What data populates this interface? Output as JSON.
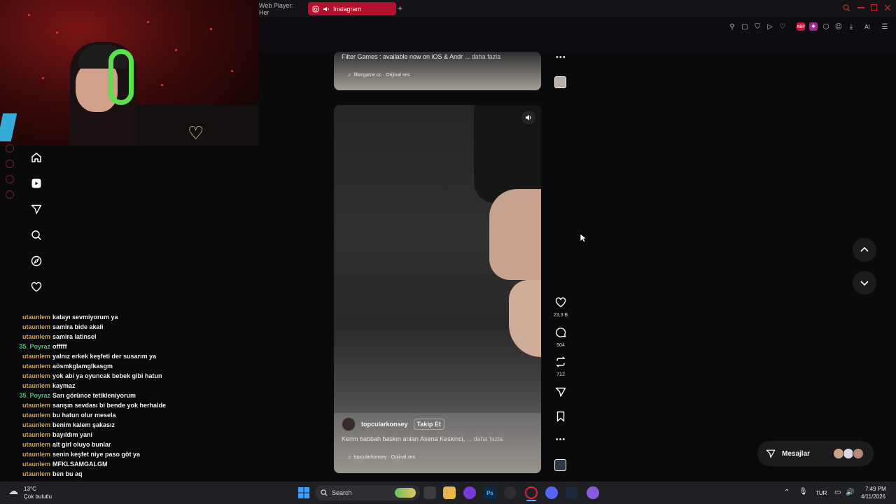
{
  "browser": {
    "tabs": [
      {
        "label": "Web Player: Her"
      },
      {
        "label": "Instagram"
      }
    ],
    "new_tab": "+",
    "ai_label": "AI"
  },
  "instagram": {
    "reel_top": {
      "caption": "Filter Games : available now on iOS & Andr",
      "more": "... daha fazla",
      "audio": "filtergame.cc · Orijinal ses"
    },
    "reel_main": {
      "username": "topcularkonsey",
      "follow": "Takip Et",
      "caption": "Kerim babbah baskın anları Asena Keskinci,",
      "more": "... daha fazla",
      "audio": "topcularkonsey · Orijinal ses"
    },
    "actions": {
      "likes": "23,3 B",
      "comments": "504",
      "reposts": "712"
    },
    "messages_label": "Mesajlar"
  },
  "chat": [
    {
      "user": "utaunlem",
      "msg": "katayı sevmiyorum ya",
      "color": "#d9a84a"
    },
    {
      "user": "utaunlem",
      "msg": "samira bide akali",
      "color": "#d9a84a"
    },
    {
      "user": "utaunlem",
      "msg": "samira latinsel",
      "color": "#d9a84a"
    },
    {
      "user": "35_Poyraz",
      "msg": "offfff",
      "color": "#4ec87a"
    },
    {
      "user": "utaunlem",
      "msg": "yalnız erkek keşfeti der susarım ya",
      "color": "#d9a84a"
    },
    {
      "user": "utaunlem",
      "msg": "aösmkglamglkasgm",
      "color": "#d9a84a"
    },
    {
      "user": "utaunlem",
      "msg": "yok abi ya oyuncak bebek gibi hatun",
      "color": "#d9a84a"
    },
    {
      "user": "utaunlem",
      "msg": "kaymaz",
      "color": "#d9a84a"
    },
    {
      "user": "35_Poyraz",
      "msg": "Sarı görünce tetikleniyorum",
      "color": "#4ec87a"
    },
    {
      "user": "utaunlem",
      "msg": "sarışın sevdası bi bende yok herhalde",
      "color": "#d9a84a"
    },
    {
      "user": "utaunlem",
      "msg": "bu hatun olur mesela",
      "color": "#d9a84a"
    },
    {
      "user": "utaunlem",
      "msg": "benim kalem şakasız",
      "color": "#d9a84a"
    },
    {
      "user": "utaunlem",
      "msg": "bayıldım yani",
      "color": "#d9a84a"
    },
    {
      "user": "utaunlem",
      "msg": "alt girl oluyo bunlar",
      "color": "#d9a84a"
    },
    {
      "user": "utaunlem",
      "msg": "senin keşfet niye paso göt ya",
      "color": "#d9a84a"
    },
    {
      "user": "utaunlem",
      "msg": "MFKLSAMGALGM",
      "color": "#d9a84a"
    },
    {
      "user": "utaunlem",
      "msg": "ben bu aq",
      "color": "#d9a84a"
    }
  ],
  "taskbar": {
    "weather_temp": "13°C",
    "weather_desc": "Çok bulutlu",
    "search_label": "Search",
    "language": "TUR",
    "time": "7:49 PM",
    "date": "4/11/2026"
  },
  "icons": {
    "home": "home-icon",
    "reels": "reels-icon",
    "send": "send-icon",
    "search": "search-icon",
    "explore": "compass-icon",
    "heart": "heart-icon"
  },
  "colors": {
    "accent": "#b3102d",
    "background": "#0a0a0c"
  }
}
